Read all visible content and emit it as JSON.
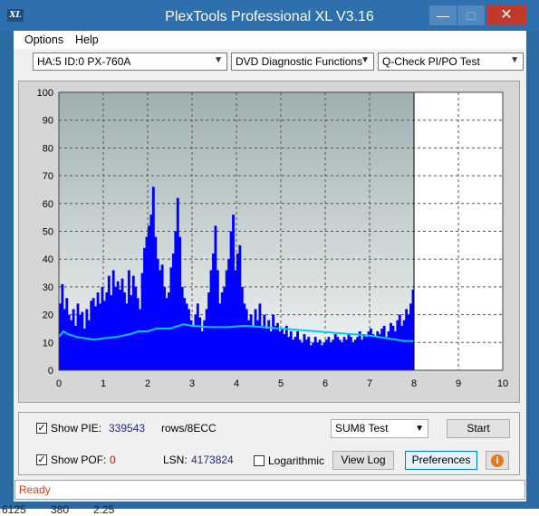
{
  "window": {
    "title": "PlexTools Professional XL V3.16",
    "app_icon_text": "XL",
    "minimize": "—",
    "maximize": "□",
    "close": "✕"
  },
  "menu": {
    "options": "Options",
    "help": "Help"
  },
  "toolbar": {
    "drive": "HA:5 ID:0  PX-760A",
    "function": "DVD Diagnostic Functions",
    "test": "Q-Check PI/PO Test"
  },
  "chart_data": {
    "type": "bar",
    "title": "",
    "xlabel": "",
    "ylabel": "",
    "xlim": [
      0,
      10
    ],
    "ylim": [
      0,
      100
    ],
    "x_ticks": [
      "0",
      "1",
      "2",
      "3",
      "4",
      "5",
      "6",
      "7",
      "8",
      "9",
      "10"
    ],
    "y_ticks": [
      "0",
      "10",
      "20",
      "30",
      "40",
      "50",
      "60",
      "70",
      "80",
      "90",
      "100"
    ],
    "grid": true,
    "colors": {
      "pie_bars": "#0000ff",
      "average_line": "#00c8ff",
      "end_marker": "#000000",
      "plot_bg_top": "#a7b5b5",
      "plot_bg_bottom": "#f2f4f4"
    },
    "end_marker_x": 8.0,
    "series": [
      {
        "x": [
          0.0,
          0.05,
          0.1,
          0.15,
          0.2,
          0.25,
          0.3,
          0.35,
          0.4,
          0.45,
          0.5,
          0.55,
          0.6,
          0.65,
          0.7,
          0.75,
          0.8,
          0.85,
          0.9,
          0.95,
          1.0,
          1.05,
          1.1,
          1.15,
          1.2,
          1.25,
          1.3,
          1.35,
          1.4,
          1.45,
          1.5,
          1.55,
          1.6,
          1.65,
          1.7,
          1.75,
          1.8,
          1.85,
          1.9,
          1.95,
          2.0,
          2.05,
          2.1,
          2.15,
          2.2,
          2.25,
          2.3,
          2.35,
          2.4,
          2.45,
          2.5,
          2.55,
          2.6,
          2.65,
          2.7,
          2.75,
          2.8,
          2.85,
          2.9,
          2.95,
          3.0,
          3.05,
          3.1,
          3.15,
          3.2,
          3.25,
          3.3,
          3.35,
          3.4,
          3.45,
          3.5,
          3.55,
          3.6,
          3.65,
          3.7,
          3.75,
          3.8,
          3.85,
          3.9,
          3.95,
          4.0,
          4.05,
          4.1,
          4.15,
          4.2,
          4.25,
          4.3,
          4.35,
          4.4,
          4.45,
          4.5,
          4.55,
          4.6,
          4.65,
          4.7,
          4.75,
          4.8,
          4.85,
          4.9,
          4.95,
          5.0,
          5.05,
          5.1,
          5.15,
          5.2,
          5.25,
          5.3,
          5.35,
          5.4,
          5.45,
          5.5,
          5.55,
          5.6,
          5.65,
          5.7,
          5.75,
          5.8,
          5.85,
          5.9,
          5.95,
          6.0,
          6.05,
          6.1,
          6.15,
          6.2,
          6.25,
          6.3,
          6.35,
          6.4,
          6.45,
          6.5,
          6.55,
          6.6,
          6.65,
          6.7,
          6.75,
          6.8,
          6.85,
          6.9,
          6.95,
          7.0,
          7.05,
          7.1,
          7.15,
          7.2,
          7.25,
          7.3,
          7.35,
          7.4,
          7.45,
          7.5,
          7.55,
          7.6,
          7.65,
          7.7,
          7.75,
          7.8,
          7.85,
          7.9,
          7.95
        ],
        "values": [
          24,
          31,
          22,
          26,
          20,
          18,
          22,
          16,
          24,
          20,
          21,
          15,
          22,
          18,
          25,
          26,
          23,
          28,
          24,
          30,
          25,
          28,
          34,
          27,
          36,
          30,
          32,
          29,
          33,
          28,
          24,
          36,
          27,
          34,
          30,
          26,
          22,
          35,
          44,
          48,
          52,
          56,
          66,
          48,
          40,
          36,
          38,
          30,
          26,
          28,
          37,
          42,
          50,
          62,
          48,
          30,
          26,
          24,
          22,
          18,
          16,
          20,
          24,
          19,
          14,
          18,
          22,
          28,
          36,
          42,
          52,
          36,
          24,
          28,
          30,
          36,
          40,
          50,
          56,
          36,
          42,
          45,
          30,
          24,
          22,
          18,
          20,
          16,
          22,
          18,
          24,
          16,
          20,
          15,
          18,
          14,
          20,
          16,
          17,
          14,
          15,
          13,
          16,
          12,
          14,
          11,
          12,
          14,
          11,
          10,
          13,
          11,
          12,
          9,
          10,
          12,
          10,
          11,
          9,
          10,
          11,
          12,
          10,
          11,
          13,
          12,
          11,
          10,
          12,
          11,
          13,
          12,
          10,
          11,
          12,
          14,
          11,
          13,
          12,
          14,
          15,
          13,
          12,
          14,
          13,
          15,
          16,
          12,
          14,
          17,
          16,
          14,
          18,
          20,
          16,
          18,
          22,
          20,
          24,
          29
        ]
      },
      {
        "x": [
          0.0,
          0.1,
          0.2,
          0.4,
          0.6,
          0.8,
          1.0,
          1.3,
          1.6,
          1.8,
          2.0,
          2.2,
          2.5,
          2.8,
          3.0,
          3.4,
          3.8,
          4.2,
          4.6,
          5.0,
          5.4,
          5.8,
          6.2,
          6.6,
          7.0,
          7.4,
          7.8,
          8.0
        ],
        "values": [
          12,
          14,
          13,
          12,
          11.5,
          11,
          11.5,
          12,
          13,
          14,
          14,
          15,
          15,
          16.5,
          16,
          15.5,
          15.5,
          16,
          15.5,
          15,
          14.5,
          14,
          13.5,
          13,
          12.5,
          11.5,
          10.5,
          10.5
        ]
      }
    ]
  },
  "bottom": {
    "show_pie_label": "Show PIE:",
    "pie_value": "339543",
    "rows_unit": "rows/8ECC",
    "show_pof_label": "Show POF:",
    "pof_value": "0",
    "lsn_label": "LSN:",
    "lsn_value": "4173824",
    "logarithmic_label": "Logarithmic",
    "sum8": "SUM8 Test",
    "start": "Start",
    "view_log": "View Log",
    "preferences": "Preferences",
    "info_icon": "info-icon"
  },
  "status": {
    "text": "Ready"
  },
  "underlay": {
    "a": "6125",
    "b": "380",
    "c": "2.25"
  }
}
